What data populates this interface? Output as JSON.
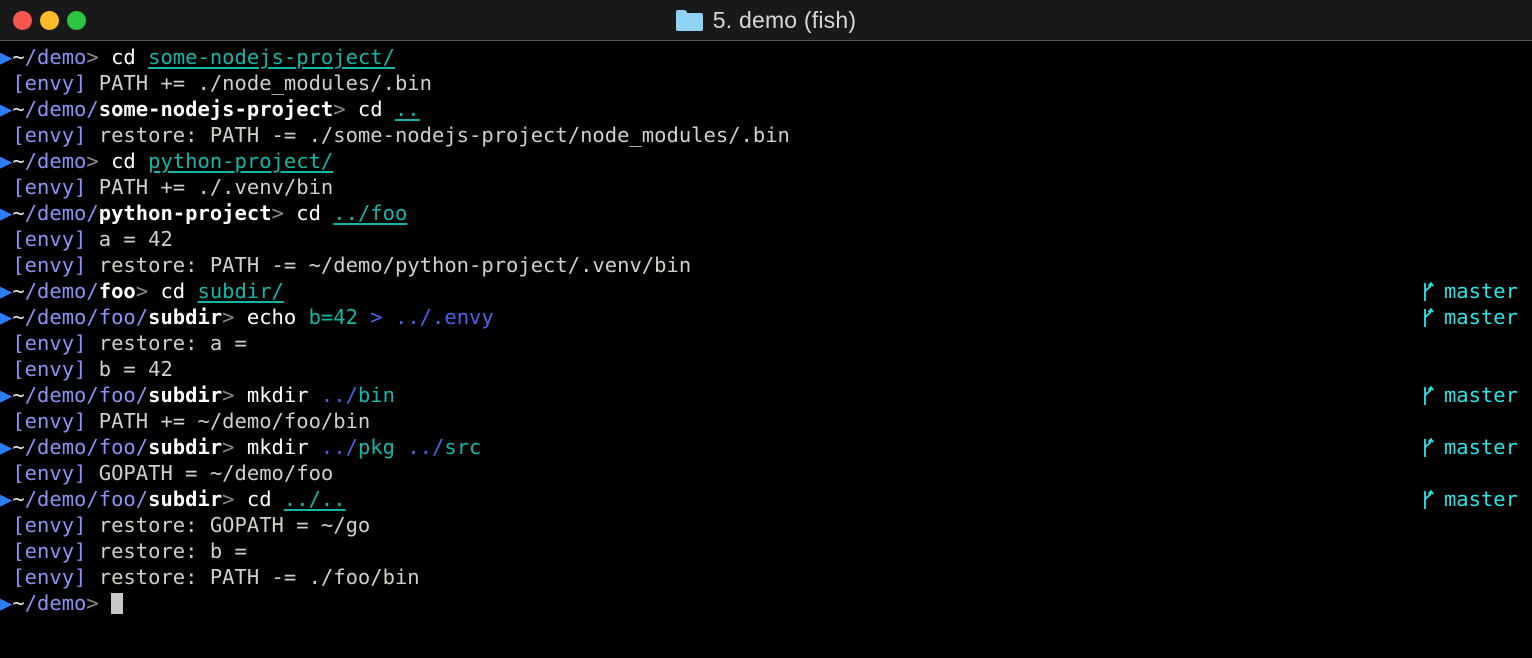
{
  "window": {
    "title": "5. demo (fish)",
    "folder_icon": "folder-icon",
    "traffic_lights": {
      "close": "close-button",
      "minimize": "minimize-button",
      "maximize": "maximize-button"
    },
    "colors": {
      "titlebar_bg": "#191919",
      "terminal_bg": "#000000",
      "prompt_arrow": "#2b7fff",
      "path": "#8d93f5",
      "cwd": "#ffffff",
      "arg_link": "#12b7a8",
      "envy_tag": "#8d93f5",
      "output": "#d4cfc6",
      "git_branch": "#2de2e6",
      "close": "#f9564f",
      "minimize": "#fbbb2c",
      "maximize": "#2bc641",
      "folder": "#8fd3f4"
    }
  },
  "terminal": {
    "prompt_arrow": "▶",
    "prompt_sep": ">",
    "git_glyph": "git-branch-icon",
    "cursor": "block-cursor",
    "lines": [
      {
        "kind": "prompt",
        "home": "~",
        "path": "/demo",
        "cwd": "",
        "command": "cd",
        "arg": "some-nodejs-project/",
        "arg_style": "link",
        "git": ""
      },
      {
        "kind": "output",
        "tag": "[envy]",
        "text": "PATH += ./node_modules/.bin"
      },
      {
        "kind": "prompt",
        "home": "~",
        "path": "/demo/",
        "cwd": "some-nodejs-project",
        "command": "cd",
        "arg": "..",
        "arg_style": "link",
        "git": ""
      },
      {
        "kind": "output",
        "tag": "[envy]",
        "text": "restore: PATH -= ./some-nodejs-project/node_modules/.bin"
      },
      {
        "kind": "prompt",
        "home": "~",
        "path": "/demo",
        "cwd": "",
        "command": "cd",
        "arg": "python-project/",
        "arg_style": "link",
        "git": ""
      },
      {
        "kind": "output",
        "tag": "[envy]",
        "text": "PATH += ./.venv/bin"
      },
      {
        "kind": "prompt",
        "home": "~",
        "path": "/demo/",
        "cwd": "python-project",
        "command": "cd",
        "arg": "../foo",
        "arg_style": "link",
        "git": ""
      },
      {
        "kind": "output",
        "tag": "[envy]",
        "text": "a = 42"
      },
      {
        "kind": "output",
        "tag": "[envy]",
        "text": "restore: PATH -= ~/demo/python-project/.venv/bin"
      },
      {
        "kind": "prompt",
        "home": "~",
        "path": "/demo/",
        "cwd": "foo",
        "command": "cd",
        "arg": "subdir/",
        "arg_style": "link",
        "git": "master"
      },
      {
        "kind": "prompt-echo",
        "home": "~",
        "path": "/demo/foo/",
        "cwd": "subdir",
        "command": "echo",
        "value": "b=42",
        "redirect": ">",
        "target": "../.envy",
        "git": "master"
      },
      {
        "kind": "output",
        "tag": "[envy]",
        "text": "restore: a ="
      },
      {
        "kind": "output",
        "tag": "[envy]",
        "text": "b = 42"
      },
      {
        "kind": "prompt-split",
        "home": "~",
        "path": "/demo/foo/",
        "cwd": "subdir",
        "command": "mkdir",
        "arg_prefix": "../",
        "arg_suffix": "bin",
        "git": "master"
      },
      {
        "kind": "output",
        "tag": "[envy]",
        "text": "PATH += ~/demo/foo/bin"
      },
      {
        "kind": "prompt-split2",
        "home": "~",
        "path": "/demo/foo/",
        "cwd": "subdir",
        "command": "mkdir",
        "arg1_prefix": "../",
        "arg1_suffix": "pkg",
        "arg2_prefix": "../",
        "arg2_suffix": "src",
        "git": "master"
      },
      {
        "kind": "output",
        "tag": "[envy]",
        "text": "GOPATH = ~/demo/foo"
      },
      {
        "kind": "prompt",
        "home": "~",
        "path": "/demo/foo/",
        "cwd": "subdir",
        "command": "cd",
        "arg": "../..",
        "arg_style": "link",
        "git": "master"
      },
      {
        "kind": "output",
        "tag": "[envy]",
        "text": "restore: GOPATH = ~/go"
      },
      {
        "kind": "output",
        "tag": "[envy]",
        "text": "restore: b ="
      },
      {
        "kind": "output",
        "tag": "[envy]",
        "text": "restore: PATH -= ./foo/bin"
      },
      {
        "kind": "prompt-cursor",
        "home": "~",
        "path": "/demo",
        "cwd": "",
        "git": ""
      }
    ]
  }
}
